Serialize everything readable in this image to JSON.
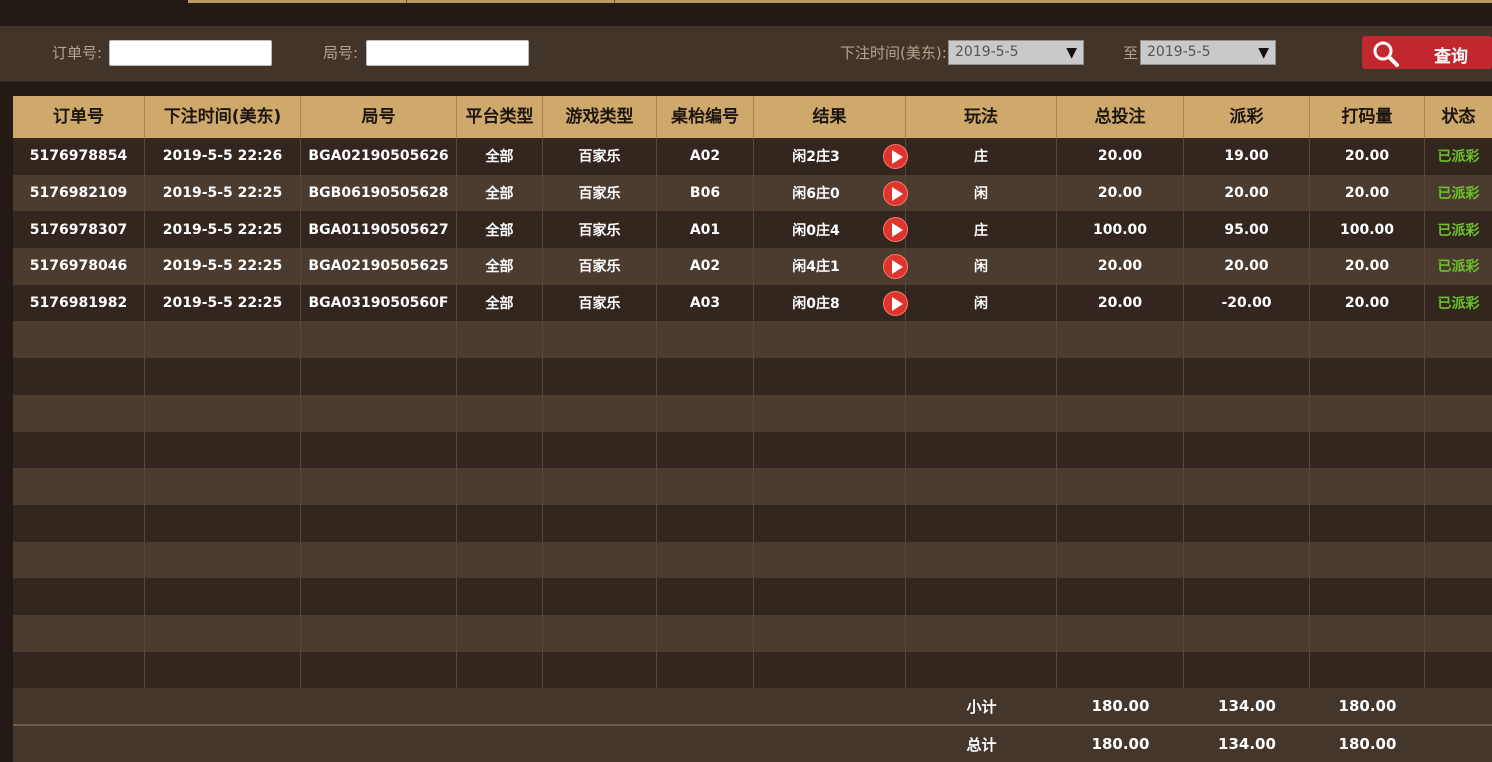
{
  "filters": {
    "order_label": "订单号:",
    "order_value": "",
    "round_label": "局号:",
    "round_value": "",
    "time_label": "下注时间(美东):",
    "date_from": "2019-5-5",
    "to_label": "至",
    "date_to": "2019-5-5",
    "query_label": "查询"
  },
  "table": {
    "headers": [
      "订单号",
      "下注时间(美东)",
      "局号",
      "平台类型",
      "游戏类型",
      "桌枱编号",
      "结果",
      "玩法",
      "总投注",
      "派彩",
      "打码量",
      "状态"
    ],
    "rows": [
      {
        "order": "5176978854",
        "time": "2019-5-5 22:26",
        "round": "BGA02190505626",
        "platform": "全部",
        "game": "百家乐",
        "table": "A02",
        "result": "闲2庄3",
        "play": "庄",
        "bet": "20.00",
        "payout": "19.00",
        "valid": "20.00",
        "status": "已派彩"
      },
      {
        "order": "5176982109",
        "time": "2019-5-5 22:25",
        "round": "BGB06190505628",
        "platform": "全部",
        "game": "百家乐",
        "table": "B06",
        "result": "闲6庄0",
        "play": "闲",
        "bet": "20.00",
        "payout": "20.00",
        "valid": "20.00",
        "status": "已派彩"
      },
      {
        "order": "5176978307",
        "time": "2019-5-5 22:25",
        "round": "BGA01190505627",
        "platform": "全部",
        "game": "百家乐",
        "table": "A01",
        "result": "闲0庄4",
        "play": "庄",
        "bet": "100.00",
        "payout": "95.00",
        "valid": "100.00",
        "status": "已派彩"
      },
      {
        "order": "5176978046",
        "time": "2019-5-5 22:25",
        "round": "BGA02190505625",
        "platform": "全部",
        "game": "百家乐",
        "table": "A02",
        "result": "闲4庄1",
        "play": "闲",
        "bet": "20.00",
        "payout": "20.00",
        "valid": "20.00",
        "status": "已派彩"
      },
      {
        "order": "5176981982",
        "time": "2019-5-5 22:25",
        "round": "BGA0319050560F",
        "platform": "全部",
        "game": "百家乐",
        "table": "A03",
        "result": "闲0庄8",
        "play": "闲",
        "bet": "20.00",
        "payout": "-20.00",
        "valid": "20.00",
        "status": "已派彩"
      }
    ],
    "empty_rows": 10
  },
  "subtotal": {
    "label": "小计",
    "bet": "180.00",
    "payout": "134.00",
    "valid": "180.00"
  },
  "total": {
    "label": "总计",
    "bet": "180.00",
    "payout": "134.00",
    "valid": "180.00"
  }
}
